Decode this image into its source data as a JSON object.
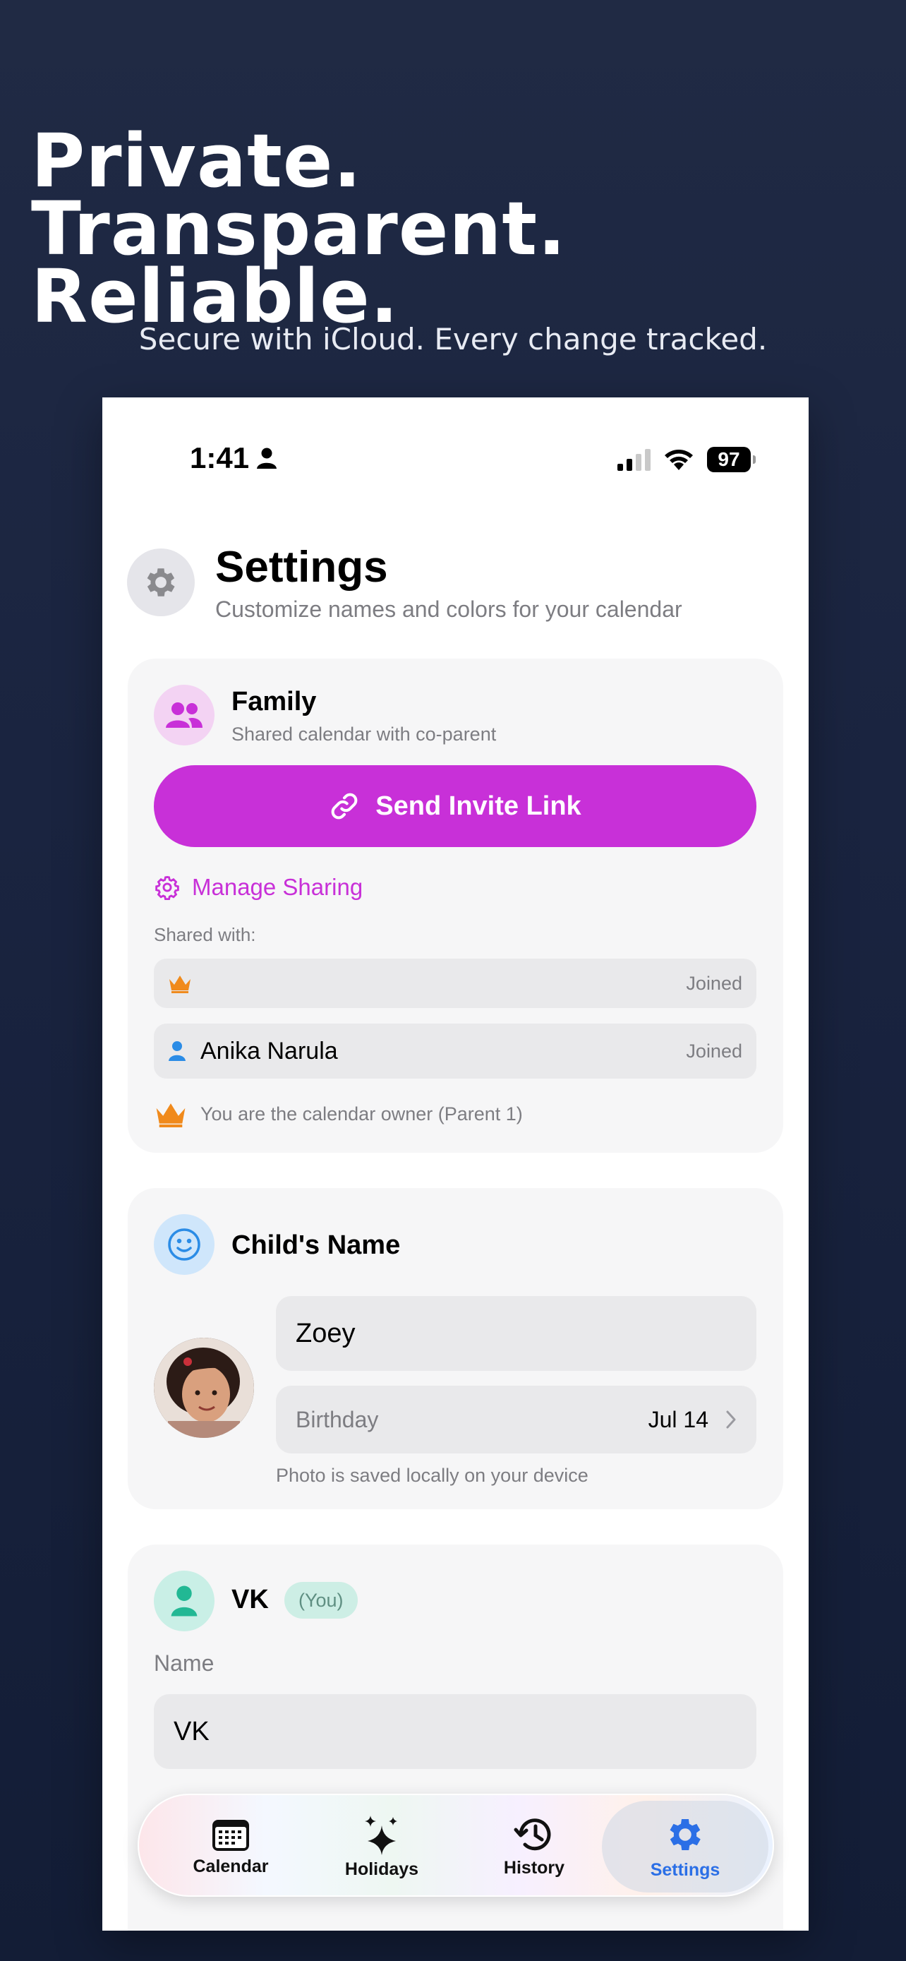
{
  "marketing": {
    "headline_line1": "Private. Transparent.",
    "headline_line2": "Reliable.",
    "subheadline": "Secure with iCloud. Every change tracked."
  },
  "status_bar": {
    "time": "1:41",
    "battery": "97"
  },
  "settings": {
    "title": "Settings",
    "subtitle": "Customize names and colors for your calendar"
  },
  "family_card": {
    "title": "Family",
    "subtitle": "Shared calendar with co-parent",
    "invite_button": "Send Invite Link",
    "manage_sharing": "Manage Sharing",
    "shared_with_label": "Shared with:",
    "members": [
      {
        "name": "",
        "status": "Joined",
        "icon": "crown-icon"
      },
      {
        "name": "Anika Narula",
        "status": "Joined",
        "icon": "person-icon"
      }
    ],
    "owner_note": "You are the calendar owner (Parent 1)",
    "accent_color": "#c830d8"
  },
  "child_card": {
    "title": "Child's Name",
    "name_value": "Zoey",
    "birthday_label": "Birthday",
    "birthday_value": "Jul 14",
    "photo_note": "Photo is saved locally on your device"
  },
  "parent_card": {
    "title": "VK",
    "badge": "(You)",
    "name_label": "Name",
    "name_value": "VK"
  },
  "tab_bar": {
    "tabs": [
      {
        "label": "Calendar",
        "icon": "calendar-icon"
      },
      {
        "label": "Holidays",
        "icon": "sparkles-icon"
      },
      {
        "label": "History",
        "icon": "history-icon"
      },
      {
        "label": "Settings",
        "icon": "gear-icon"
      }
    ],
    "active": "Settings",
    "active_color": "#2b6fe6"
  }
}
